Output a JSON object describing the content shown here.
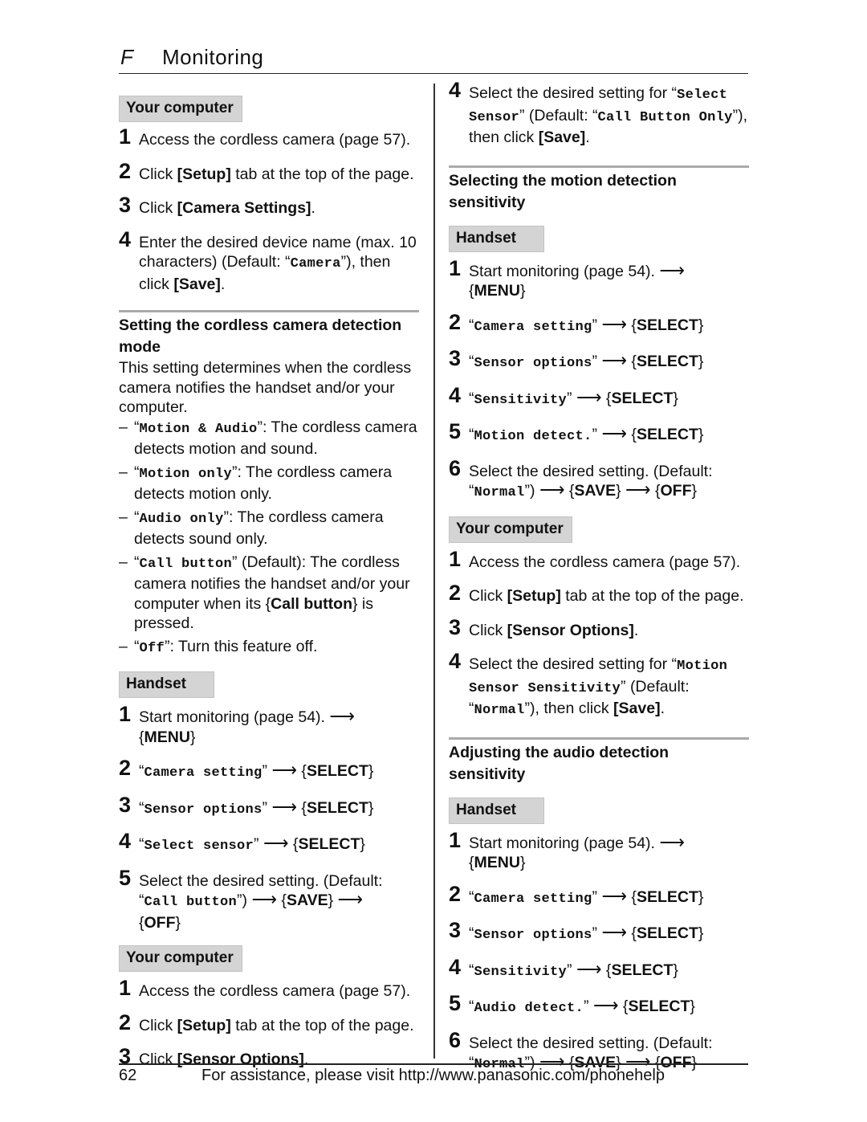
{
  "header": {
    "letter": "F",
    "title": "Monitoring"
  },
  "footer": {
    "page_number": "62",
    "text": "For assistance, please visit http://www.panasonic.com/phonehelp"
  },
  "glyphs": {
    "arrow": "⟶",
    "dash": "–",
    "lq": "“",
    "rq": "”",
    "lb": "{",
    "rb": "}"
  },
  "left": {
    "block1": {
      "tag": "Your computer",
      "steps": [
        {
          "num": "1",
          "text": "Access the cordless camera (page 57)."
        },
        {
          "num": "2",
          "pre": "Click ",
          "bold": "[Setup]",
          "post": " tab at the top of the page."
        },
        {
          "num": "3",
          "pre": "Click ",
          "bold": "[Camera Settings]",
          "post": "."
        },
        {
          "num": "4",
          "pre": "Enter the desired device name (max. 10 characters) (Default: “",
          "mono": "Camera",
          "mid": "”), then click ",
          "bold": "[Save]",
          "post": "."
        }
      ]
    },
    "section1": {
      "title": "Setting the cordless camera detection mode",
      "intro": "This setting determines when the cordless camera notifies the handset and/or your computer.",
      "options": [
        {
          "mono": "Motion & Audio",
          "text": ": The cordless camera detects motion and sound."
        },
        {
          "mono": "Motion only",
          "text": ": The cordless camera detects motion only."
        },
        {
          "mono": "Audio only",
          "text": ": The cordless camera detects sound only."
        },
        {
          "mono": "Call button",
          "text": " (Default): The cordless camera notifies the handset and/or your computer when its ",
          "bold": "Call button",
          "post": " is pressed."
        },
        {
          "mono": "Off",
          "text": ": Turn this feature off."
        }
      ]
    },
    "handset": {
      "tag": "Handset",
      "steps": [
        {
          "num": "1",
          "text": "Start monitoring (page 54).",
          "key": "MENU"
        },
        {
          "num": "2",
          "mono": "Camera setting",
          "key": "SELECT"
        },
        {
          "num": "3",
          "mono": "Sensor options",
          "key": "SELECT"
        },
        {
          "num": "4",
          "mono": "Select sensor",
          "key": "SELECT"
        },
        {
          "num": "5",
          "text": "Select the desired setting. (Default:",
          "mono": "Call button",
          "key": "SAVE",
          "key2": "OFF"
        }
      ]
    },
    "computer2": {
      "tag": "Your computer",
      "steps": [
        {
          "num": "1",
          "text": "Access the cordless camera (page 57)."
        },
        {
          "num": "2",
          "pre": "Click ",
          "bold": "[Setup]",
          "post": " tab at the top of the page."
        },
        {
          "num": "3",
          "pre": "Click ",
          "bold": "[Sensor Options]",
          "post": "."
        }
      ]
    }
  },
  "right": {
    "step4": {
      "num": "4",
      "pre": "Select the desired setting for “",
      "mono": "Select Sensor",
      "mid": "” (Default: “",
      "mono2": "Call Button Only",
      "mid2": "”), then click ",
      "bold": "[Save]",
      "post": "."
    },
    "section2": {
      "title": "Selecting the motion detection sensitivity",
      "handset": {
        "tag": "Handset",
        "steps": [
          {
            "num": "1",
            "text": "Start monitoring (page 54).",
            "key": "MENU"
          },
          {
            "num": "2",
            "mono": "Camera setting",
            "key": "SELECT"
          },
          {
            "num": "3",
            "mono": "Sensor options",
            "key": "SELECT"
          },
          {
            "num": "4",
            "mono": "Sensitivity",
            "key": "SELECT"
          },
          {
            "num": "5",
            "mono": "Motion detect.",
            "key": "SELECT"
          },
          {
            "num": "6",
            "text": "Select the desired setting. (Default:",
            "mono": "Normal",
            "key": "SAVE",
            "key2": "OFF"
          }
        ]
      },
      "computer": {
        "tag": "Your computer",
        "steps": [
          {
            "num": "1",
            "text": "Access the cordless camera (page 57)."
          },
          {
            "num": "2",
            "pre": "Click ",
            "bold": "[Setup]",
            "post": " tab at the top of the page."
          },
          {
            "num": "3",
            "pre": "Click ",
            "bold": "[Sensor Options]",
            "post": "."
          },
          {
            "num": "4",
            "pre": "Select the desired setting for “",
            "mono": "Motion Sensor Sensitivity",
            "mid": "” (Default: “",
            "mono2": "Normal",
            "mid2": "”), then click ",
            "bold": "[Save]",
            "post": "."
          }
        ]
      }
    },
    "section3": {
      "title": "Adjusting the audio detection sensitivity",
      "handset": {
        "tag": "Handset",
        "steps": [
          {
            "num": "1",
            "text": "Start monitoring (page 54).",
            "key": "MENU"
          },
          {
            "num": "2",
            "mono": "Camera setting",
            "key": "SELECT"
          },
          {
            "num": "3",
            "mono": "Sensor options",
            "key": "SELECT"
          },
          {
            "num": "4",
            "mono": "Sensitivity",
            "key": "SELECT"
          },
          {
            "num": "5",
            "mono": "Audio detect.",
            "key": "SELECT"
          },
          {
            "num": "6",
            "text": "Select the desired setting. (Default:",
            "mono": "Normal",
            "key": "SAVE",
            "key2": "OFF"
          }
        ]
      }
    }
  }
}
